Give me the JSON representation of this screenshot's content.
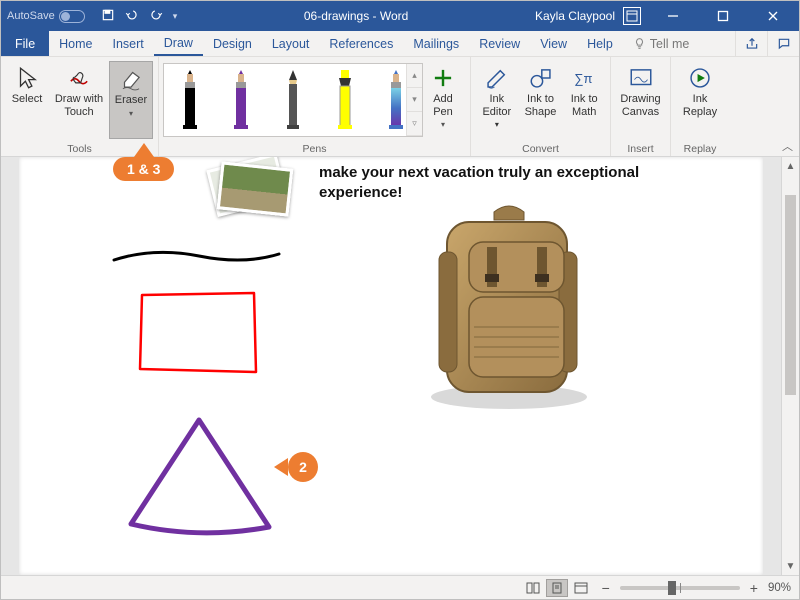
{
  "titlebar": {
    "autosave_label": "AutoSave",
    "doc_title": "06-drawings - Word",
    "username": "Kayla Claypool"
  },
  "menu": {
    "file": "File",
    "tabs": [
      "Home",
      "Insert",
      "Draw",
      "Design",
      "Layout",
      "References",
      "Mailings",
      "Review",
      "View",
      "Help"
    ],
    "active_tab_index": 2,
    "tellme_icon": "lightbulb",
    "tellme": "Tell me"
  },
  "ribbon": {
    "tools": {
      "label": "Tools",
      "select": "Select",
      "draw_with_touch": "Draw with Touch",
      "eraser": "Eraser"
    },
    "pens": {
      "label": "Pens",
      "add_pen": "Add Pen",
      "pen_list": [
        {
          "type": "pen",
          "color": "#000000"
        },
        {
          "type": "pen",
          "color": "#7030a0"
        },
        {
          "type": "pen",
          "color": "#404040"
        },
        {
          "type": "highlighter",
          "color": "#ffff00"
        },
        {
          "type": "galaxy",
          "color": "#4472c4"
        }
      ]
    },
    "convert": {
      "label": "Convert",
      "ink_editor": "Ink Editor",
      "ink_to_shape": "Ink to Shape",
      "ink_to_math": "Ink to Math"
    },
    "insert": {
      "label": "Insert",
      "drawing_canvas": "Drawing Canvas"
    },
    "replay": {
      "label": "Replay",
      "ink_replay": "Ink Replay"
    }
  },
  "callouts": {
    "one_three": "1 & 3",
    "two": "2"
  },
  "document": {
    "body_text": "make your next vacation truly an exceptional experience!",
    "shapes": {
      "squiggle_color": "#000000",
      "rect_color": "#ff0000",
      "triangle_color": "#7030a0"
    },
    "image": "backpack"
  },
  "status": {
    "zoom_percent": "90%"
  }
}
